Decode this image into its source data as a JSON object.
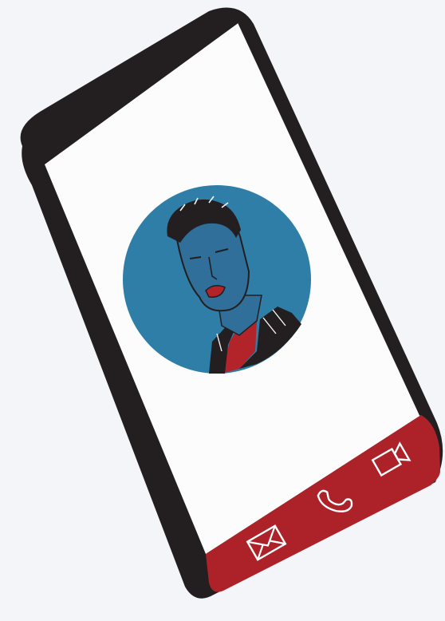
{
  "illustration": {
    "subject": "phone-contact-illustration",
    "colors": {
      "background": "#f4f5f8",
      "phone_body": "#231f20",
      "screen": "#fcfcfd",
      "avatar_circle": "#2e7ea8",
      "skin": "#2f6f99",
      "action_bar": "#ac2228",
      "shirt": "#b3242a",
      "icon_stroke": "#ffffff"
    },
    "avatar": {
      "icon": "user-portrait"
    },
    "action_bar": {
      "buttons": [
        {
          "icon": "envelope-icon",
          "action": "message"
        },
        {
          "icon": "phone-icon",
          "action": "call"
        },
        {
          "icon": "video-camera-icon",
          "action": "video-call"
        }
      ]
    }
  }
}
